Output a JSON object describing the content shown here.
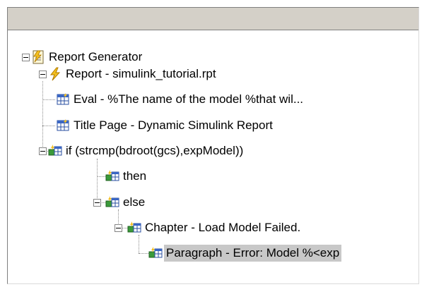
{
  "tree": {
    "items": [
      {
        "label": "Report Generator",
        "icon": "report-generator-icon"
      },
      {
        "label": "Report - simulink_tutorial.rpt",
        "icon": "report-lightning-icon"
      },
      {
        "label": "Eval - %The name of the model %that wil...",
        "icon": "table-component-icon"
      },
      {
        "label": "Title Page - Dynamic Simulink Report",
        "icon": "table-component-icon"
      },
      {
        "label": "if (strcmp(bdroot(gcs),expModel))",
        "icon": "logical-component-icon"
      },
      {
        "label": "then",
        "icon": "logical-component-icon"
      },
      {
        "label": "else",
        "icon": "logical-component-icon"
      },
      {
        "label": "Chapter - Load Model Failed.",
        "icon": "logical-component-icon"
      },
      {
        "label": "Paragraph - Error: Model %<exp",
        "icon": "logical-component-icon",
        "selected": true
      }
    ]
  }
}
